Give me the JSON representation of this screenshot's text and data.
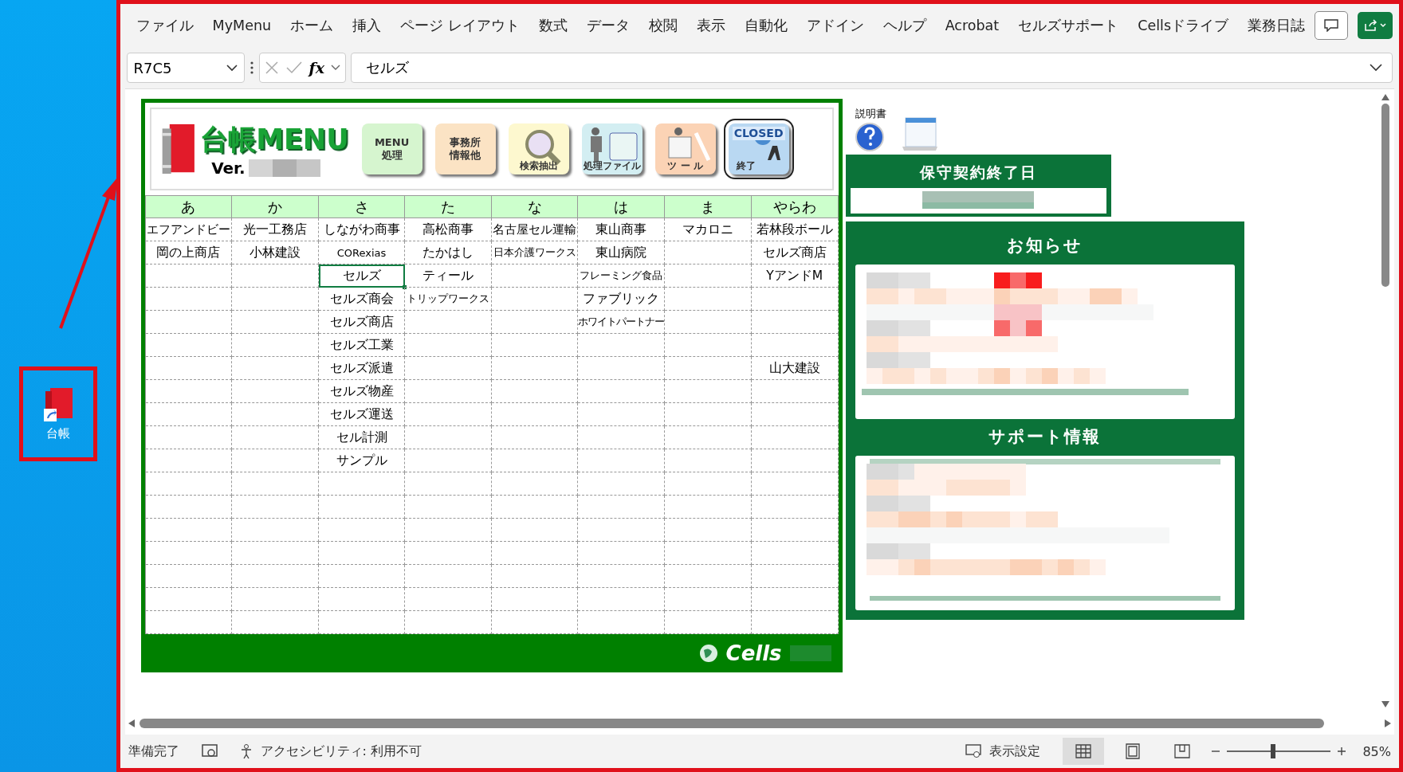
{
  "desktop": {
    "icon_label": "台帳"
  },
  "ribbon_tabs": [
    {
      "label": "ファイル"
    },
    {
      "label": "MyMenu"
    },
    {
      "label": "ホーム"
    },
    {
      "label": "挿入"
    },
    {
      "label": "ページ レイアウト"
    },
    {
      "label": "数式"
    },
    {
      "label": "データ"
    },
    {
      "label": "校閲"
    },
    {
      "label": "表示"
    },
    {
      "label": "自動化"
    },
    {
      "label": "アドイン"
    },
    {
      "label": "ヘルプ"
    },
    {
      "label": "Acrobat"
    },
    {
      "label": "セルズサポート"
    },
    {
      "label": "Cellsドライブ"
    },
    {
      "label": "業務日誌"
    }
  ],
  "formula_bar": {
    "name_box": "R7C5",
    "function_label": "fx",
    "formula": "セルズ"
  },
  "menu_panel": {
    "title": "台帳MENU",
    "version_label": "Ver.",
    "buttons": [
      {
        "kind": "text",
        "lines": [
          "MENU",
          "処理"
        ],
        "color": "#d6f5cf"
      },
      {
        "kind": "text",
        "lines": [
          "事務所",
          "情報他"
        ],
        "color": "#fbe3c4"
      },
      {
        "kind": "search",
        "lines": [
          "検索抽出"
        ],
        "color": "#fdf8cf"
      },
      {
        "kind": "files",
        "lines": [
          "処理ファイル"
        ],
        "color": "#d3eef2"
      },
      {
        "kind": "tools",
        "lines": [
          "ツ ー ル"
        ],
        "color": "#fbd3b5"
      },
      {
        "kind": "close",
        "lines": [
          "CLOSED",
          "終了"
        ],
        "color": "#b9d8f2"
      }
    ]
  },
  "table": {
    "columns": [
      "あ",
      "か",
      "さ",
      "た",
      "な",
      "は",
      "ま",
      "やらわ"
    ],
    "rows": [
      [
        {
          "text": "エフアンドビー",
          "selected": false
        },
        {
          "text": "光一工務店",
          "selected": false
        },
        {
          "text": "しながわ商事",
          "selected": false
        },
        {
          "text": "高松商事",
          "selected": false
        },
        {
          "text": "名古屋セル運輸",
          "selected": false
        },
        {
          "text": "東山商事",
          "selected": false
        },
        {
          "text": "マカロニ",
          "selected": false
        },
        {
          "text": "若林段ボール",
          "selected": false
        }
      ],
      [
        {
          "text": "岡の上商店",
          "selected": false
        },
        {
          "text": "小林建設",
          "selected": false
        },
        {
          "text": "CORexias",
          "selected": false
        },
        {
          "text": "たかはし",
          "selected": false
        },
        {
          "text": "日本介護ワークス",
          "selected": false
        },
        {
          "text": "東山病院",
          "selected": false
        },
        {
          "selected": false
        },
        {
          "text": "セルズ商店",
          "selected": false
        }
      ],
      [
        {
          "selected": false
        },
        {
          "selected": false
        },
        {
          "text": "セルズ",
          "selected": true
        },
        {
          "text": "ティール",
          "selected": false
        },
        {
          "selected": false
        },
        {
          "text": "フレーミング食品",
          "selected": false
        },
        {
          "selected": false
        },
        {
          "text": "YアンドM",
          "selected": false
        }
      ],
      [
        {
          "selected": false
        },
        {
          "selected": false
        },
        {
          "text": "セルズ商会",
          "selected": false
        },
        {
          "text": "トリップワークス",
          "selected": false
        },
        {
          "selected": false
        },
        {
          "text": "ファブリック",
          "selected": false
        },
        {
          "selected": false
        },
        {
          "selected": false
        }
      ],
      [
        {
          "selected": false
        },
        {
          "selected": false
        },
        {
          "text": "セルズ商店",
          "selected": false
        },
        {
          "selected": false
        },
        {
          "selected": false
        },
        {
          "text": "ホワイトパートナー",
          "selected": false
        },
        {
          "selected": false
        },
        {
          "selected": false
        }
      ],
      [
        {
          "selected": false
        },
        {
          "selected": false
        },
        {
          "text": "セルズ工業",
          "selected": false
        },
        {
          "selected": false
        },
        {
          "selected": false
        },
        {
          "selected": false
        },
        {
          "selected": false
        },
        {
          "selected": false
        }
      ],
      [
        {
          "selected": false
        },
        {
          "selected": false
        },
        {
          "text": "セルズ派遣",
          "selected": false
        },
        {
          "selected": false
        },
        {
          "selected": false
        },
        {
          "selected": false
        },
        {
          "selected": false
        },
        {
          "text": "山大建設",
          "selected": false
        }
      ],
      [
        {
          "selected": false
        },
        {
          "selected": false
        },
        {
          "text": "セルズ物産",
          "selected": false
        },
        {
          "selected": false
        },
        {
          "selected": false
        },
        {
          "selected": false
        },
        {
          "selected": false
        },
        {
          "selected": false
        }
      ],
      [
        {
          "selected": false
        },
        {
          "selected": false
        },
        {
          "text": "セルズ運送",
          "selected": false
        },
        {
          "selected": false
        },
        {
          "selected": false
        },
        {
          "selected": false
        },
        {
          "selected": false
        },
        {
          "selected": false
        }
      ],
      [
        {
          "selected": false
        },
        {
          "selected": false
        },
        {
          "text": "セル計測",
          "selected": false
        },
        {
          "selected": false
        },
        {
          "selected": false
        },
        {
          "selected": false
        },
        {
          "selected": false
        },
        {
          "selected": false
        }
      ],
      [
        {
          "selected": false
        },
        {
          "selected": false
        },
        {
          "text": "サンプル",
          "selected": false
        },
        {
          "selected": false
        },
        {
          "selected": false
        },
        {
          "selected": false
        },
        {
          "selected": false
        },
        {
          "selected": false
        }
      ]
    ]
  },
  "footer": {
    "brand": "Cells"
  },
  "side": {
    "manual_label": "説明書",
    "maintenance_title": "保守契約終了日",
    "notices_title": "お知らせ",
    "support_title": "サポート情報"
  },
  "status_bar": {
    "status": "準備完了",
    "accessibility": "アクセシビリティ: 利用不可",
    "display_settings": "表示設定",
    "views": [
      {
        "kind": "normal",
        "selected": true
      },
      {
        "kind": "page",
        "selected": false
      },
      {
        "kind": "break",
        "selected": false
      }
    ],
    "zoom_slider": {
      "level": 0.44
    },
    "zoom": "85%"
  }
}
